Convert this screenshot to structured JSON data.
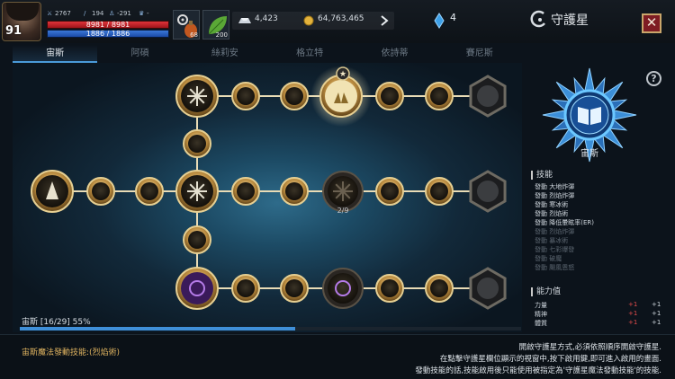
{
  "player": {
    "level": "91",
    "attack": "2767",
    "stat2": "194",
    "stat3": "-291",
    "stat4": "-",
    "hp_text": "8981 / 8981",
    "hp_fraction": 1.0,
    "mp_text": "1886 / 1886",
    "mp_fraction": 1.0
  },
  "quickslots": [
    {
      "icon": "gear-potion-icon",
      "count": "68"
    },
    {
      "icon": "leaf-icon",
      "count": "200"
    }
  ],
  "currency": {
    "silver": "4,423",
    "gold": "64,763,465",
    "gems": "4"
  },
  "panel": {
    "title": "守護星",
    "close_label": "✕"
  },
  "tabs": [
    "宙斯",
    "阿碩",
    "絲莉安",
    "格立特",
    "依詩蒂",
    "賽尼斯"
  ],
  "active_tab": 0,
  "tree": {
    "node_counter": "2/9",
    "progress_label": "宙斯 [16/29] 55%",
    "progress_fraction": 0.55
  },
  "emblem": {
    "name": "宙斯",
    "help_label": "?"
  },
  "skills": {
    "heading": "技能",
    "items": [
      {
        "label": "發動 大地炸彈",
        "active": true
      },
      {
        "label": "發動 烈焰炸彈",
        "active": true
      },
      {
        "label": "發動 寒冰術",
        "active": true
      },
      {
        "label": "發動 烈焰術",
        "active": true
      },
      {
        "label": "發動 降低暈眩率(ER)",
        "active": true
      },
      {
        "label": "發動 烈焰炸彈",
        "active": false
      },
      {
        "label": "發動 暴冰術",
        "active": false
      },
      {
        "label": "發動 七彩爆發",
        "active": false
      },
      {
        "label": "發動 破魔",
        "active": false
      },
      {
        "label": "發動 颶風恩怒",
        "active": false
      }
    ]
  },
  "attributes": {
    "heading": "能力值",
    "items": [
      {
        "label": "力量",
        "bonus": "+1",
        "total": "+1"
      },
      {
        "label": "精神",
        "bonus": "+1",
        "total": "+1"
      },
      {
        "label": "體質",
        "bonus": "+1",
        "total": "+1"
      }
    ]
  },
  "footer": {
    "spell": "宙斯魔法發動技能:(烈焰術)",
    "hint1": "開啟守護星方式,必須依照順序開啟守護星.",
    "hint2": "在點擊守護星欄位顯示的視窗中,按下啟用鍵,即可進入啟用的畫面.",
    "hint3": "發動技能的話,技能啟用後只能使用被指定為'守護星魔法發動技能'的技能."
  },
  "colors": {
    "accent_blue": "#3f8fd8",
    "gold": "#c9a66b",
    "hp_red": "#e0343a",
    "mp_blue": "#3b78d8",
    "close_red": "#7e1c23",
    "bonus_red": "#e34b4b"
  }
}
